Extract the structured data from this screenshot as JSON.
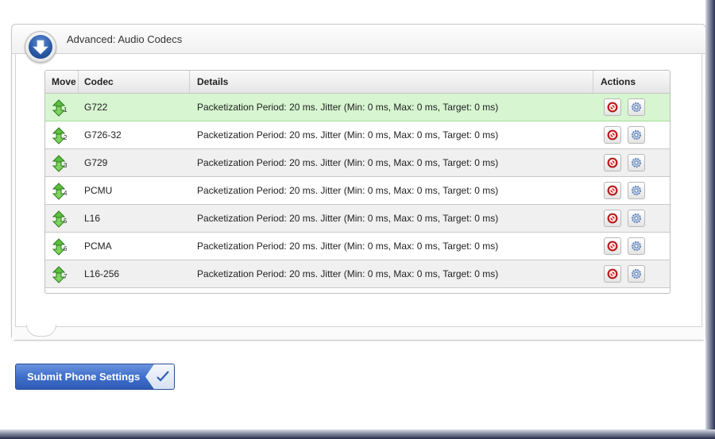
{
  "panel": {
    "title": "Advanced: Audio Codecs",
    "toggle_icon": "arrow-down-circle-icon"
  },
  "table": {
    "columns": [
      "Move",
      "Codec",
      "Details",
      "Actions"
    ],
    "rows": [
      {
        "index": "1",
        "codec": "G722",
        "details": "Packetization Period: 20 ms. Jitter (Min: 0 ms, Max: 0 ms, Target: 0 ms)",
        "selected": true
      },
      {
        "index": "2",
        "codec": "G726-32",
        "details": "Packetization Period: 20 ms. Jitter (Min: 0 ms, Max: 0 ms, Target: 0 ms)",
        "selected": false
      },
      {
        "index": "3",
        "codec": "G729",
        "details": "Packetization Period: 20 ms. Jitter (Min: 0 ms, Max: 0 ms, Target: 0 ms)",
        "selected": false
      },
      {
        "index": "4",
        "codec": "PCMU",
        "details": "Packetization Period: 20 ms. Jitter (Min: 0 ms, Max: 0 ms, Target: 0 ms)",
        "selected": false
      },
      {
        "index": "5",
        "codec": "L16",
        "details": "Packetization Period: 20 ms. Jitter (Min: 0 ms, Max: 0 ms, Target: 0 ms)",
        "selected": false
      },
      {
        "index": "6",
        "codec": "PCMA",
        "details": "Packetization Period: 20 ms. Jitter (Min: 0 ms, Max: 0 ms, Target: 0 ms)",
        "selected": false
      },
      {
        "index": "7",
        "codec": "L16-256",
        "details": "Packetization Period: 20 ms. Jitter (Min: 0 ms, Max: 0 ms, Target: 0 ms)",
        "selected": false
      }
    ],
    "row_icons": {
      "move": "move-up-down-icon",
      "disable": "disable-icon",
      "settings": "gear-icon"
    }
  },
  "submit": {
    "label": "Submit Phone Settings",
    "icon": "checkmark-icon"
  },
  "colors": {
    "selected_row": "#d6f5d0",
    "button_blue": "#3f6fcb",
    "move_green": "#4caf3a",
    "disable_red": "#d62020"
  }
}
